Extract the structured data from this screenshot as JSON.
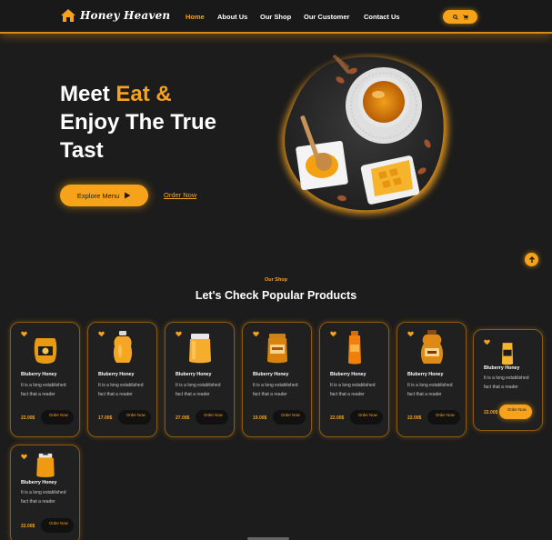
{
  "brand": {
    "name": "Honey Heaven",
    "accent": "#f7a21b"
  },
  "nav": {
    "items": [
      {
        "label": "Home",
        "active": true
      },
      {
        "label": "About Us",
        "active": false
      },
      {
        "label": "Our Shop",
        "active": false
      },
      {
        "label": "Our Customer",
        "active": false
      },
      {
        "label": "Contact Us",
        "active": false
      }
    ],
    "icons": [
      "search-icon",
      "cart-icon"
    ]
  },
  "hero": {
    "line1_a": "Meet ",
    "line1_b": "Eat &",
    "line2": "Enjoy The True",
    "line3": "Tast",
    "explore_label": "Explore Menu",
    "order_label": "Order Now"
  },
  "section": {
    "label": "Our Shop",
    "title": "Let's Check Popular Products"
  },
  "products": [
    {
      "name": "Bluberry Honey",
      "desc": "It is a long established fact that a reader",
      "price": "22.00$",
      "order": "Order Now"
    },
    {
      "name": "Bluberry Honey",
      "desc": "It is a long established fact that a reader",
      "price": "17.00$",
      "order": "Order Now"
    },
    {
      "name": "Bluberry Honey",
      "desc": "It is a long established fact that a reader",
      "price": "27.00$",
      "order": "Order Now"
    },
    {
      "name": "Bluberry Honey",
      "desc": "It is a long established fact that a reader",
      "price": "19.00$",
      "order": "Order Now"
    },
    {
      "name": "Bluberry Honey",
      "desc": "It is a long established fact that a reader",
      "price": "22.00$",
      "order": "Order Now"
    },
    {
      "name": "Bluberry Honey",
      "desc": "It is a long established fact that a reader",
      "price": "22.00$",
      "order": "Order Now"
    },
    {
      "name": "Bluberry Honey",
      "desc": "It is a long established fact that a reader",
      "price": "22.00$",
      "order": "Order Now"
    },
    {
      "name": "Bluberry Honey",
      "desc": "It is a long established fact that a reader",
      "price": "22.00$",
      "order": "Order Now"
    }
  ]
}
